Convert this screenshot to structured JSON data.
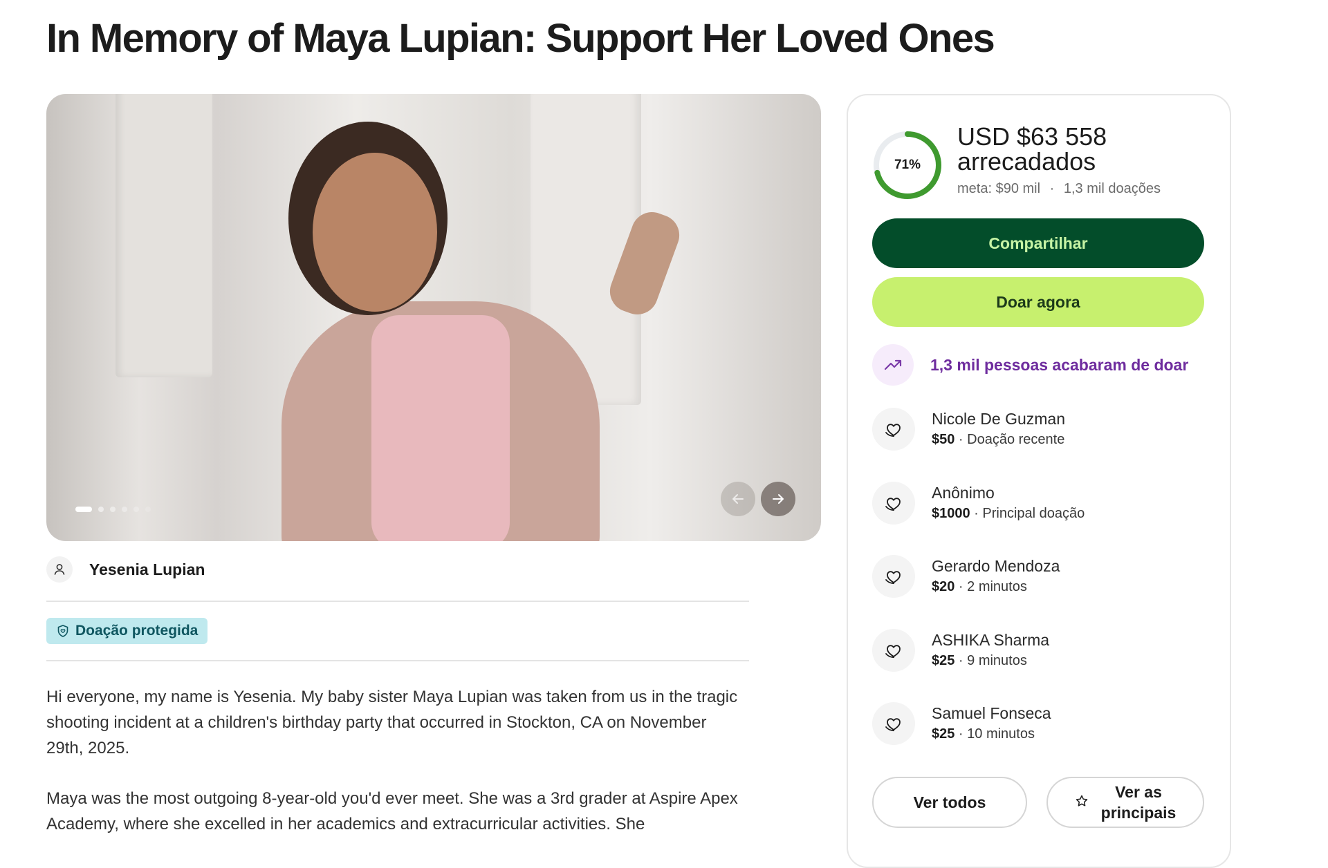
{
  "page": {
    "title": "In Memory of Maya Lupian: Support Her Loved Ones"
  },
  "hero": {
    "slide_count": 6,
    "active_slide": 1
  },
  "organizer": {
    "name": "Yesenia Lupian"
  },
  "badge": {
    "label": "Doação protegida"
  },
  "story": {
    "paragraphs": [
      "Hi everyone, my name is Yesenia. My baby sister Maya Lupian was taken from us in the tragic shooting incident at a children's birthday party that occurred in Stockton, CA on November 29th, 2025.",
      "Maya was the most outgoing 8-year-old you'd ever meet. She was a 3rd grader at Aspire Apex Academy, where she excelled in her academics and extracurricular activities. She"
    ]
  },
  "fundraiser": {
    "progress_percent": 71,
    "progress_label": "71%",
    "raised_amount": "USD $63 558",
    "raised_label": "arrecadados",
    "goal": "meta: $90 mil",
    "separator": "·",
    "donation_count": "1,3 mil doações",
    "share_label": "Compartilhar",
    "donate_label": "Doar agora",
    "trend_text": "1,3 mil pessoas acabaram de doar"
  },
  "donations": [
    {
      "name": "Nicole De Guzman",
      "amount": "$50",
      "detail": " · Doação recente"
    },
    {
      "name": "Anônimo",
      "amount": "$1000",
      "detail": " · Principal doação"
    },
    {
      "name": "Gerardo Mendoza",
      "amount": "$20",
      "detail": " · 2 minutos"
    },
    {
      "name": "ASHIKA Sharma",
      "amount": "$25",
      "detail": " · 9 minutos"
    },
    {
      "name": "Samuel Fonseca",
      "amount": "$25",
      "detail": " · 10 minutos"
    }
  ],
  "actions": {
    "see_all_label": "Ver todos",
    "see_top_label_line1": "Ver as",
    "see_top_label_line2": "principais"
  },
  "colors": {
    "progress_track": "#e9ecef",
    "progress_fill": "#3f9a2f",
    "share_bg": "#034d2a",
    "donate_bg": "#c7f06e",
    "trend_text": "#6e2c9e",
    "badge_bg": "#bfe9ee"
  }
}
